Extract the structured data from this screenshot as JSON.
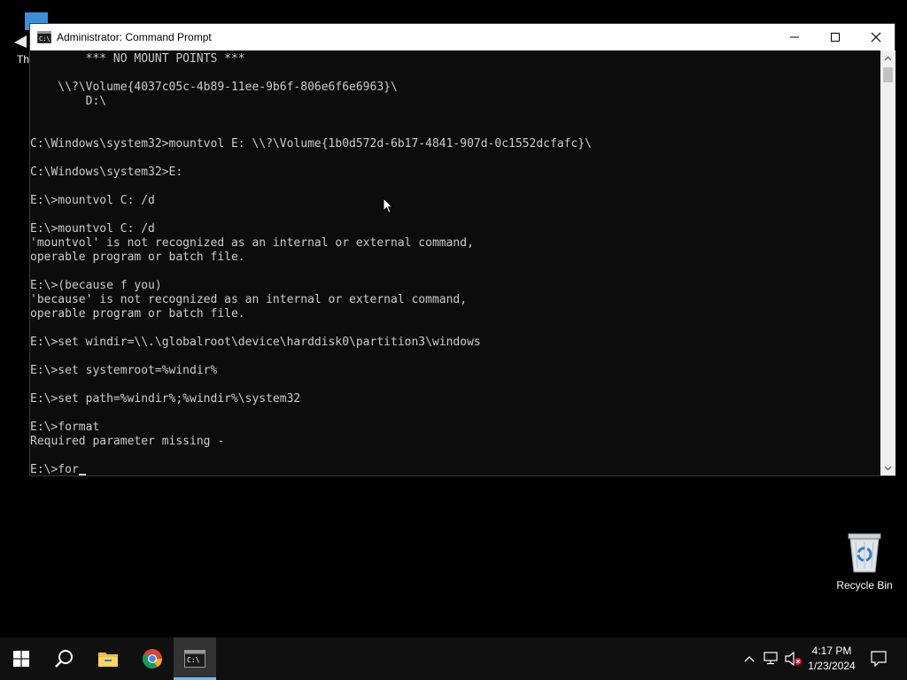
{
  "window": {
    "title": "Administrator: Command Prompt",
    "icon": "cmd-icon"
  },
  "console": {
    "lines": [
      "        *** NO MOUNT POINTS ***",
      "",
      "    \\\\?\\Volume{4037c05c-4b89-11ee-9b6f-806e6f6e6963}\\",
      "        D:\\",
      "",
      "",
      "C:\\Windows\\system32>mountvol E: \\\\?\\Volume{1b0d572d-6b17-4841-907d-0c1552dcfafc}\\",
      "",
      "C:\\Windows\\system32>E:",
      "",
      "E:\\>mountvol C: /d",
      "",
      "E:\\>mountvol C: /d",
      "'mountvol' is not recognized as an internal or external command,",
      "operable program or batch file.",
      "",
      "E:\\>(because f you)",
      "'because' is not recognized as an internal or external command,",
      "operable program or batch file.",
      "",
      "E:\\>set windir=\\\\.\\globalroot\\device\\harddisk0\\partition3\\windows",
      "",
      "E:\\>set systemroot=%windir%",
      "",
      "E:\\>set path=%windir%;%windir%\\system32",
      "",
      "E:\\>format",
      "Required parameter missing -",
      "",
      "E:\\>for"
    ],
    "text_color": "#cccccc",
    "background": "#0c0c0c"
  },
  "desktop": {
    "icons": [
      {
        "label": "Thi",
        "icon": "this-pc-icon"
      },
      {
        "label": "Recycle Bin",
        "icon": "recycle-bin-icon"
      }
    ]
  },
  "taskbar": {
    "items": [
      {
        "icon": "windows-start-icon"
      },
      {
        "icon": "search-icon"
      },
      {
        "icon": "file-explorer-icon"
      },
      {
        "icon": "chrome-icon"
      },
      {
        "icon": "command-prompt-icon",
        "active": true
      }
    ],
    "tray": {
      "time": "4:17 PM",
      "date": "1/23/2024",
      "icons": [
        "chevron-up-icon",
        "network-icon",
        "volume-muted-icon",
        "notifications-icon"
      ]
    },
    "accent": "#76b9ed"
  }
}
